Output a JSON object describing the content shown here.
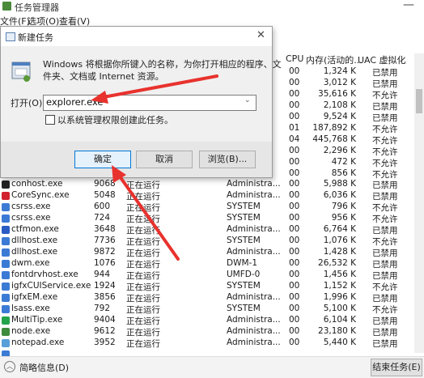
{
  "window": {
    "title": "任务管理器"
  },
  "menu": [
    "文件(F)",
    "选项(O)",
    "查看(V)"
  ],
  "columns": {
    "cpu": "CPU",
    "memory": "内存(活动的...",
    "uac": "UAC 虚拟化"
  },
  "top_rows": [
    {
      "cpu": "00",
      "mem": "1,324 K",
      "uac": "已禁用"
    },
    {
      "cpu": "00",
      "mem": "3,012 K",
      "uac": "已禁用"
    },
    {
      "cpu": "00",
      "mem": "35,616 K",
      "uac": "不允许"
    },
    {
      "cpu": "00",
      "mem": "2,108 K",
      "uac": "已禁用"
    },
    {
      "cpu": "00",
      "mem": "9,524 K",
      "uac": "已禁用"
    },
    {
      "cpu": "01",
      "mem": "187,892 K",
      "uac": "不允许"
    },
    {
      "cpu": "04",
      "mem": "445,768 K",
      "uac": "不允许"
    },
    {
      "cpu": "00",
      "mem": "2,296 K",
      "uac": "不允许"
    },
    {
      "cpu": "00",
      "mem": "472 K",
      "uac": "不允许"
    },
    {
      "cpu": "00",
      "mem": "856 K",
      "uac": "不允许"
    }
  ],
  "processes": [
    {
      "name": "conhost.exe",
      "pid": "9068",
      "status": "正在运行",
      "user": "Administra...",
      "cpu": "00",
      "mem": "5,988 K",
      "uac": "已禁用",
      "icon": "console-icon",
      "color": "#222222"
    },
    {
      "name": "CoreSync.exe",
      "pid": "5048",
      "status": "正在运行",
      "user": "Administra...",
      "cpu": "00",
      "mem": "6,036 K",
      "uac": "已禁用",
      "icon": "coresync-icon",
      "color": "#d3202f"
    },
    {
      "name": "csrss.exe",
      "pid": "600",
      "status": "正在运行",
      "user": "SYSTEM",
      "cpu": "00",
      "mem": "796 K",
      "uac": "不允许",
      "icon": "window-icon",
      "color": "#3c7bd5"
    },
    {
      "name": "csrss.exe",
      "pid": "724",
      "status": "正在运行",
      "user": "SYSTEM",
      "cpu": "00",
      "mem": "956 K",
      "uac": "不允许",
      "icon": "window-icon",
      "color": "#3c7bd5"
    },
    {
      "name": "ctfmon.exe",
      "pid": "3648",
      "status": "正在运行",
      "user": "Administra...",
      "cpu": "00",
      "mem": "6,764 K",
      "uac": "已禁用",
      "icon": "pen-icon",
      "color": "#2a5cc4"
    },
    {
      "name": "dllhost.exe",
      "pid": "7736",
      "status": "正在运行",
      "user": "SYSTEM",
      "cpu": "00",
      "mem": "1,076 K",
      "uac": "不允许",
      "icon": "window-icon",
      "color": "#3c7bd5"
    },
    {
      "name": "dllhost.exe",
      "pid": "9872",
      "status": "正在运行",
      "user": "Administra...",
      "cpu": "00",
      "mem": "1,428 K",
      "uac": "已禁用",
      "icon": "window-icon",
      "color": "#3c7bd5"
    },
    {
      "name": "dwm.exe",
      "pid": "1076",
      "status": "正在运行",
      "user": "DWM-1",
      "cpu": "00",
      "mem": "26,532 K",
      "uac": "已禁用",
      "icon": "window-icon",
      "color": "#3c7bd5"
    },
    {
      "name": "fontdrvhost.exe",
      "pid": "944",
      "status": "正在运行",
      "user": "UMFD-0",
      "cpu": "00",
      "mem": "1,456 K",
      "uac": "已禁用",
      "icon": "window-icon",
      "color": "#3c7bd5"
    },
    {
      "name": "igfxCUIService.exe",
      "pid": "1924",
      "status": "正在运行",
      "user": "SYSTEM",
      "cpu": "00",
      "mem": "1,152 K",
      "uac": "不允许",
      "icon": "window-icon",
      "color": "#3c7bd5"
    },
    {
      "name": "igfxEM.exe",
      "pid": "3856",
      "status": "正在运行",
      "user": "Administra...",
      "cpu": "00",
      "mem": "1,996 K",
      "uac": "已禁用",
      "icon": "window-icon",
      "color": "#3c7bd5"
    },
    {
      "name": "lsass.exe",
      "pid": "792",
      "status": "正在运行",
      "user": "SYSTEM",
      "cpu": "00",
      "mem": "5,100 K",
      "uac": "不允许",
      "icon": "window-icon",
      "color": "#3c7bd5"
    },
    {
      "name": "MultiTip.exe",
      "pid": "9404",
      "status": "正在运行",
      "user": "Administra...",
      "cpu": "00",
      "mem": "6,104 K",
      "uac": "已禁用",
      "icon": "multitip-icon",
      "color": "#22a44a"
    },
    {
      "name": "node.exe",
      "pid": "9612",
      "status": "正在运行",
      "user": "Administra...",
      "cpu": "00",
      "mem": "23,180 K",
      "uac": "已禁用",
      "icon": "node-icon",
      "color": "#3d8b3d"
    },
    {
      "name": "notepad.exe",
      "pid": "3952",
      "status": "正在运行",
      "user": "Administra...",
      "cpu": "00",
      "mem": "5,440 K",
      "uac": "已禁用",
      "icon": "notepad-icon",
      "color": "#5aa0d8"
    },
    {
      "name": "",
      "pid": "",
      "status": "",
      "user": "",
      "cpu": "",
      "mem": "",
      "uac": "",
      "icon": "window-icon",
      "color": "#3c7bd5"
    }
  ],
  "footer": {
    "summary": "简略信息(D)",
    "end_task": "结束任务(E)"
  },
  "run_dialog": {
    "title": "新建任务",
    "description_line1": "Windows 将根据你所键入的名称，为你打开相应的程序、文",
    "description_line2": "件夹、文档或 Internet 资源。",
    "open_label": "打开(O):",
    "input_value": "explorer.exe",
    "admin_checkbox_label": "以系统管理权限创建此任务。",
    "ok": "确定",
    "cancel": "取消",
    "browse": "浏览(B)...",
    "arrow_color": "#e8322e"
  }
}
